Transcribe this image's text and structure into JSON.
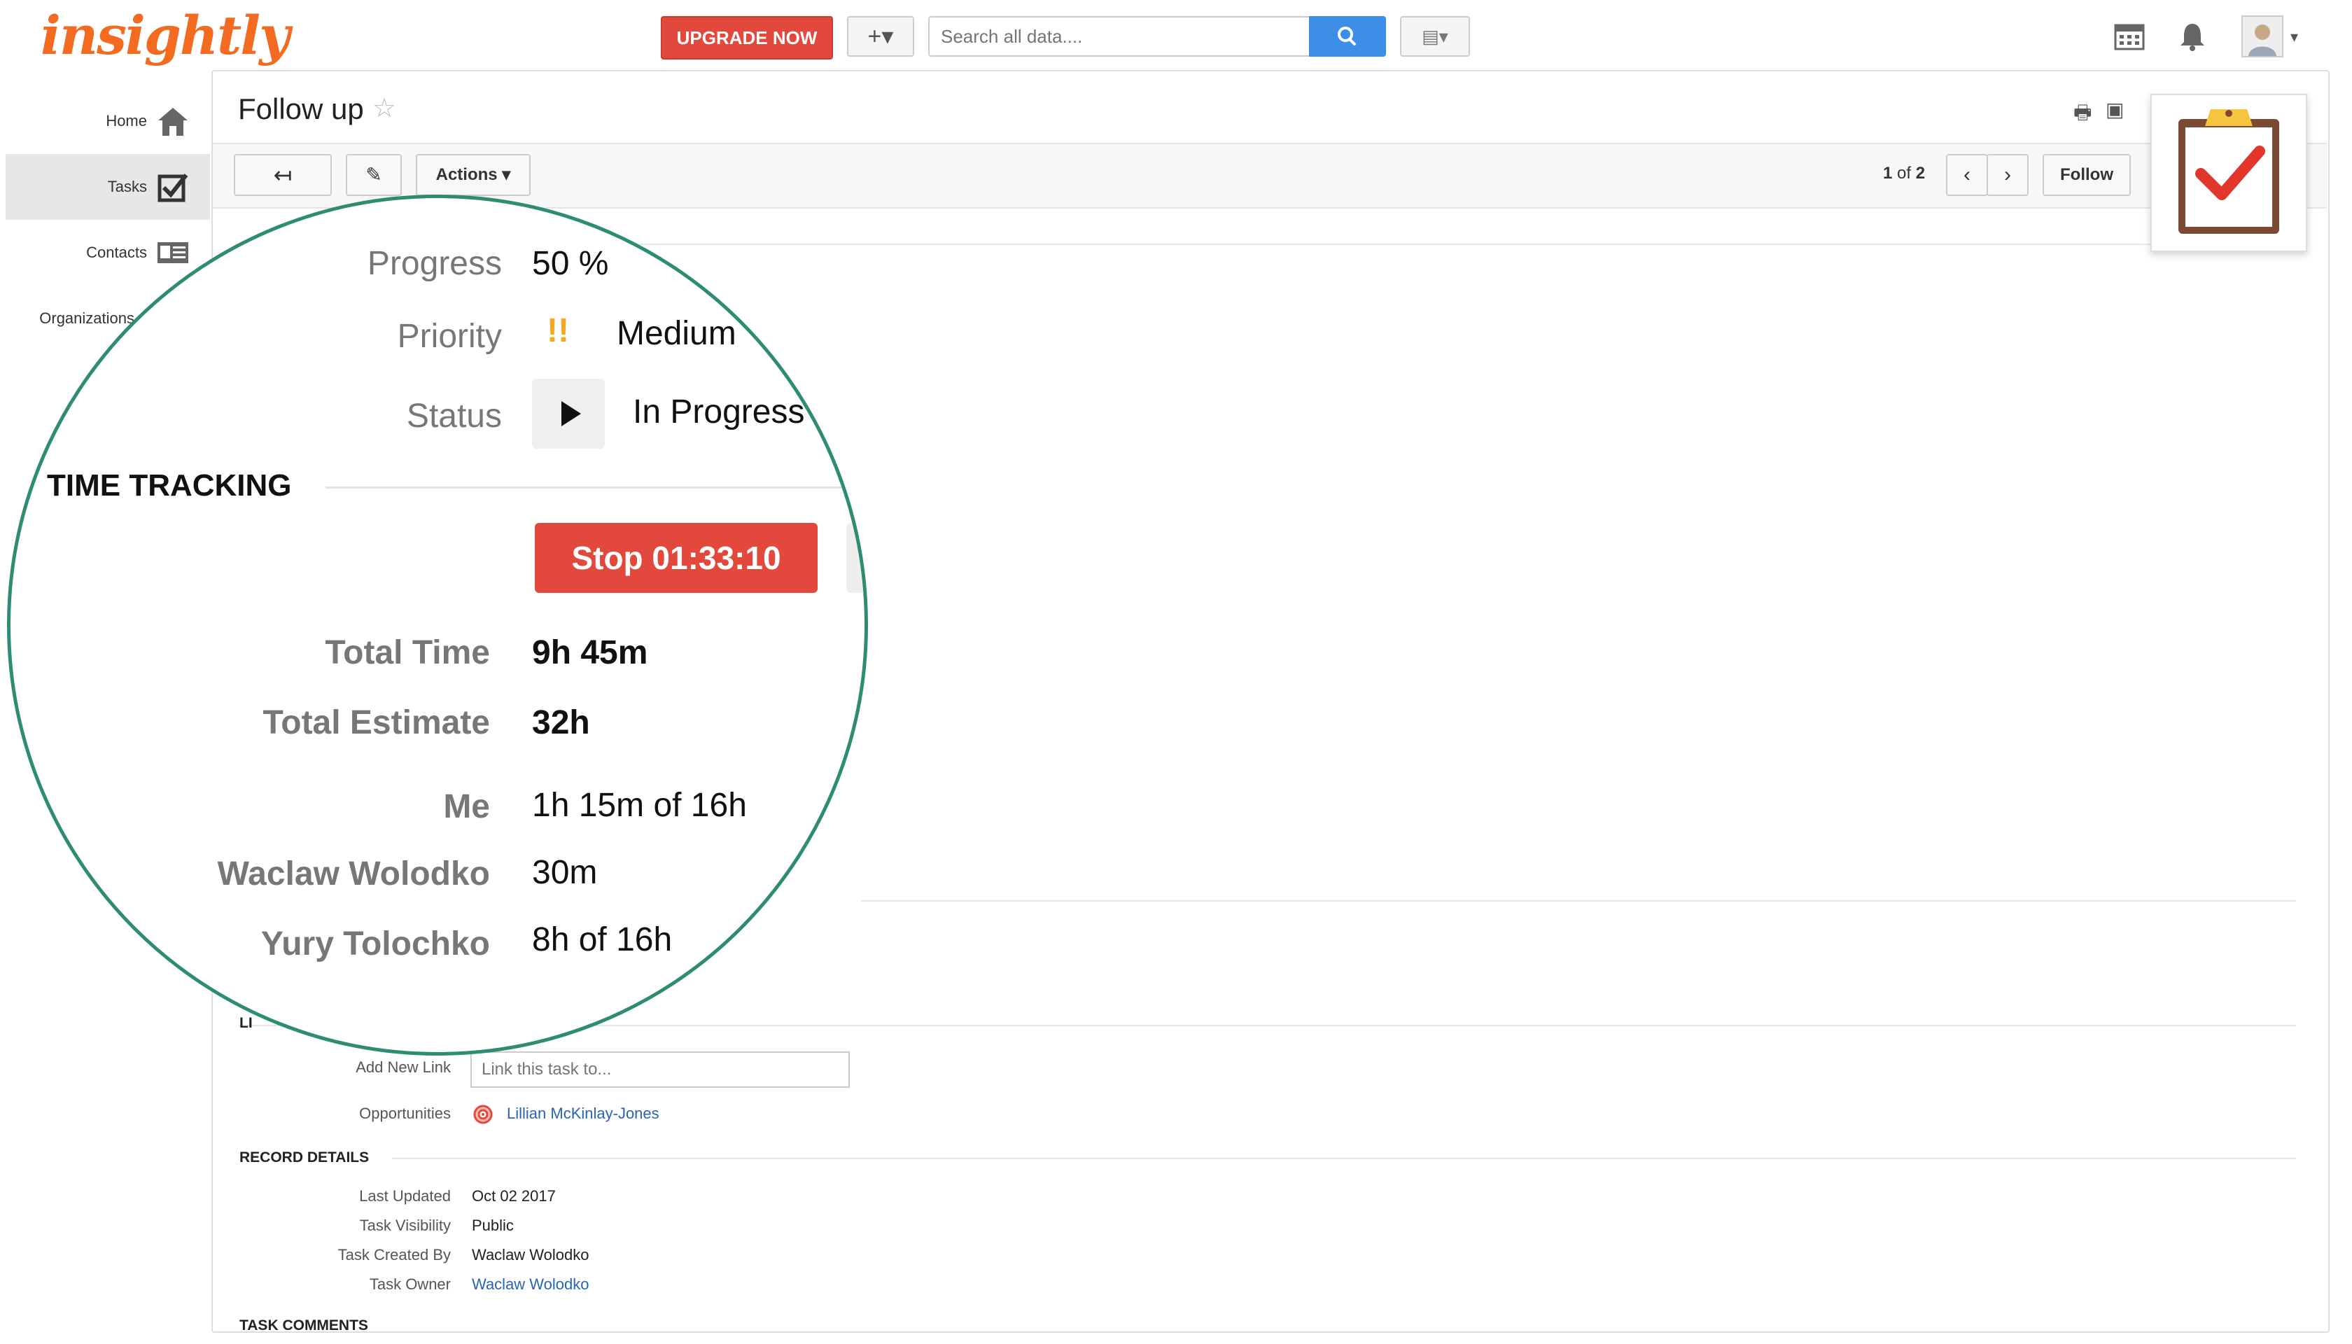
{
  "app": {
    "logo_text": "insightly",
    "brand_color": "#f26b21"
  },
  "header": {
    "upgrade_label": "UPGRADE NOW",
    "add_label": "+▾",
    "search_placeholder": "Search all data....",
    "view_label": "▤▾"
  },
  "sidebar": {
    "items": [
      {
        "label": "Home",
        "icon": "home-icon"
      },
      {
        "label": "Tasks",
        "icon": "tasks-icon"
      },
      {
        "label": "Contacts",
        "icon": "contacts-icon"
      },
      {
        "label": "Organizations",
        "icon": "organizations-icon"
      }
    ]
  },
  "task": {
    "title": "Follow up",
    "star": "☆",
    "toolbar": {
      "back": "↤",
      "edit": "✎",
      "actions": "Actions ▾",
      "counter_current": "1",
      "counter_of": " of ",
      "counter_total": "2",
      "prev": "‹",
      "next": "›",
      "follow": "Follow"
    }
  },
  "magnifier": {
    "progress_label": "Progress",
    "progress_value": "50 %",
    "priority_label": "Priority",
    "priority_icon": "!!",
    "priority_value": "Medium",
    "status_label": "Status",
    "status_value": "In Progress",
    "section_title": "TIME TRACKING",
    "stop_label": "Stop  01:33:10",
    "rows": [
      {
        "label": "Total Time",
        "value": "9h 45m"
      },
      {
        "label": "Total Estimate",
        "value": "32h"
      },
      {
        "label": "Me",
        "value": "1h 15m of 16h"
      },
      {
        "label": "Waclaw Wolodko",
        "value": "30m"
      },
      {
        "label": "Yury Tolochko",
        "value": "8h of 16h"
      }
    ]
  },
  "links": {
    "section_partial": "LI",
    "add_new_label": "Add New Link",
    "input_placeholder": "Link this task to...",
    "opportunities_label": "Opportunities",
    "opportunity_value": "Lillian McKinlay-Jones"
  },
  "record": {
    "section_title": "RECORD DETAILS",
    "rows": [
      {
        "label": "Last Updated",
        "value": "Oct 02 2017"
      },
      {
        "label": "Task Visibility",
        "value": "Public"
      },
      {
        "label": "Task Created By",
        "value": "Waclaw Wolodko"
      },
      {
        "label": "Task Owner",
        "value": "Waclaw Wolodko"
      }
    ]
  },
  "comments": {
    "section_title": "TASK COMMENTS"
  },
  "colors": {
    "accent_red": "#e2483b",
    "search_blue": "#3c8ee6",
    "magnifier_ring": "#2e8b74",
    "link_blue": "#2a63b5"
  }
}
